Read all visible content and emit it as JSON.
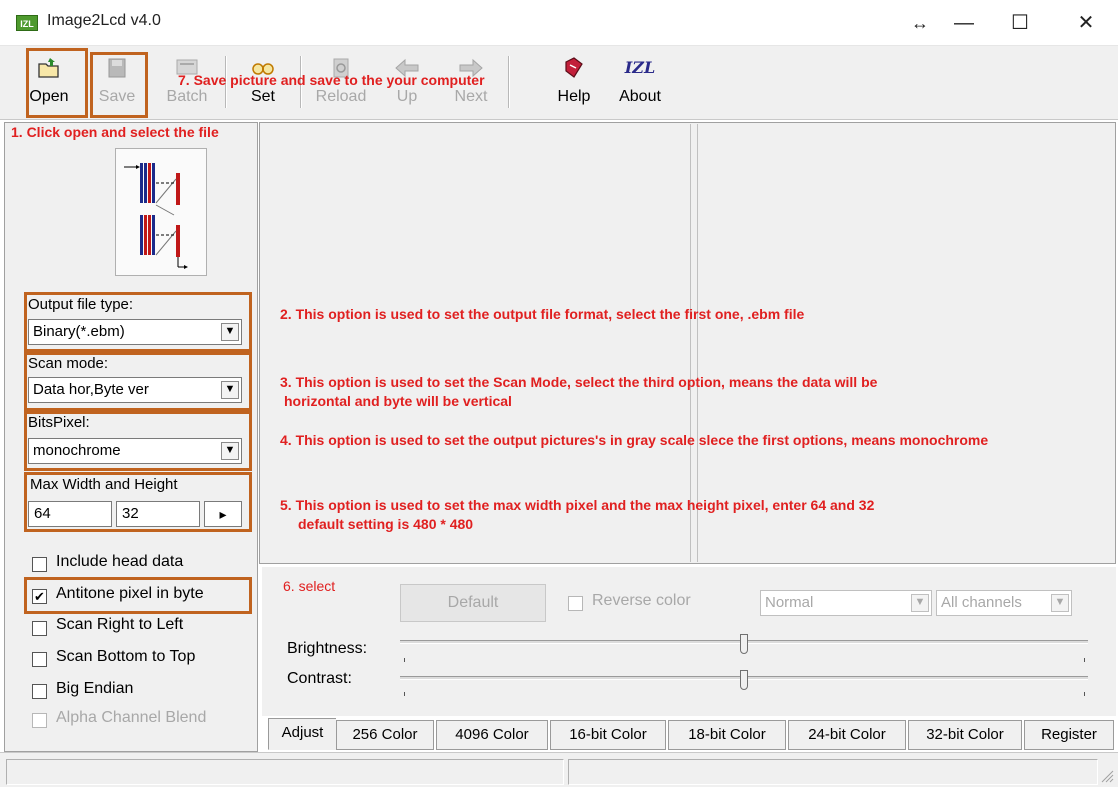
{
  "window": {
    "icon_text": "IZL",
    "title": "Image2Lcd v4.0",
    "controls": [
      "↔",
      "—",
      "☐",
      "✕"
    ]
  },
  "toolbar": {
    "buttons": [
      {
        "label": "Open",
        "icon": "folder-open-icon",
        "enabled": true
      },
      {
        "label": "Save",
        "icon": "save-disk-icon",
        "enabled": false
      },
      {
        "label": "Batch",
        "icon": "batch-icon",
        "enabled": false
      },
      {
        "label": "Set",
        "icon": "glasses-icon",
        "enabled": true
      },
      {
        "label": "Reload",
        "icon": "reload-icon",
        "enabled": false
      },
      {
        "label": "Up",
        "icon": "arrow-left-icon",
        "enabled": false
      },
      {
        "label": "Next",
        "icon": "arrow-right-icon",
        "enabled": false
      },
      {
        "label": "Help",
        "icon": "help-book-icon",
        "enabled": true
      },
      {
        "label": "About",
        "icon": "izl-logo-icon",
        "enabled": true
      }
    ]
  },
  "notes": {
    "n1": "1. Click open and select the file",
    "n2": "2. This option is used to set the output file format, select the first one, .ebm file",
    "n3a": "3. This option is used to set the Scan Mode, select the third option, means the data will be",
    "n3b": "horizontal and byte will be vertical",
    "n4": "4. This  option is used to set the output pictures's in gray scale slece the first options, means monochrome",
    "n5a": "5. This option is used to set the max width pixel and the max height pixel, enter 64 and 32",
    "n5b": "default setting is 480 * 480",
    "n6": "6. select",
    "n7": "7. Save picture and save to the your computer"
  },
  "left": {
    "output_type": {
      "label": "Output file type:",
      "value": "Binary(*.ebm)"
    },
    "scan_mode": {
      "label": "Scan mode:",
      "value": "Data hor,Byte ver"
    },
    "bits_pixel": {
      "label": "BitsPixel:",
      "value": "monochrome"
    },
    "max_size": {
      "label": "Max Width and Height",
      "width": "64",
      "height": "32",
      "arrow": "▸"
    },
    "checkboxes": [
      {
        "label": "Include head data",
        "checked": false,
        "enabled": true
      },
      {
        "label": "Antitone pixel in byte",
        "checked": true,
        "enabled": true
      },
      {
        "label": "Scan Right to Left",
        "checked": false,
        "enabled": true
      },
      {
        "label": "Scan Bottom to Top",
        "checked": false,
        "enabled": true
      },
      {
        "label": "Big Endian",
        "checked": false,
        "enabled": true
      },
      {
        "label": "Alpha Channel Blend",
        "checked": false,
        "enabled": false
      }
    ]
  },
  "adjust": {
    "default_label": "Default",
    "reverse_label": "Reverse color",
    "mode_value": "Normal",
    "channels_value": "All channels",
    "brightness_label": "Brightness:",
    "contrast_label": "Contrast:",
    "brightness_level": 0.5,
    "contrast_level": 0.5
  },
  "tabs": [
    "Adjust",
    "256 Color",
    "4096 Color",
    "16-bit Color",
    "18-bit Color",
    "24-bit Color",
    "32-bit Color",
    "Register"
  ],
  "colors": {
    "annotation": "#e02020",
    "highlight_box": "#c0631f"
  }
}
